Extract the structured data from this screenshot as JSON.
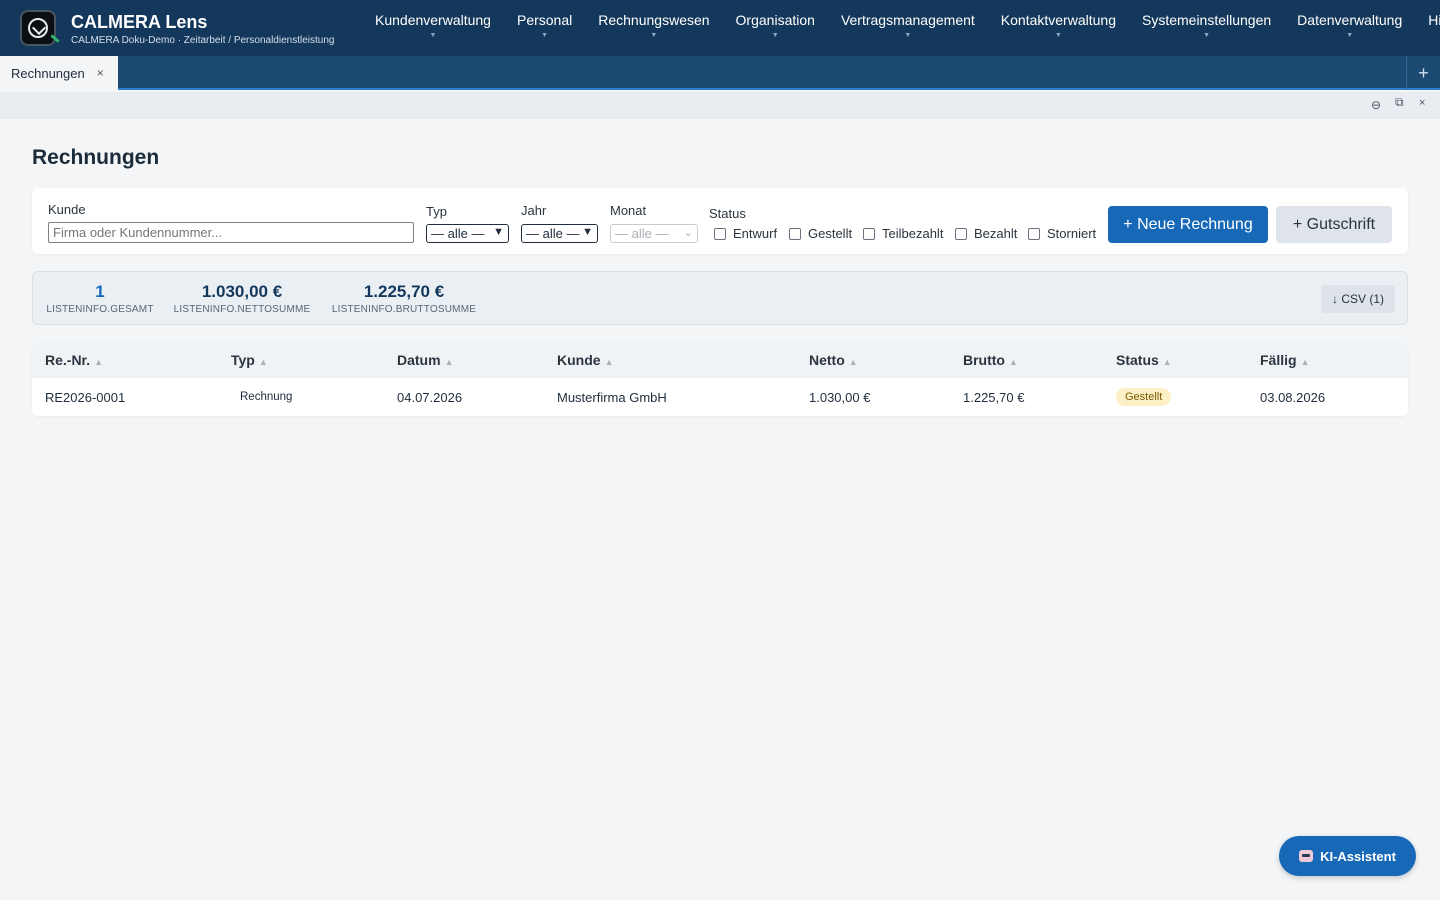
{
  "app": {
    "title": "CALMERA Lens",
    "subtitle": "CALMERA Doku-Demo · Zeitarbeit / Personaldienstleistung"
  },
  "nav": {
    "items": [
      {
        "label": "Kundenverwaltung"
      },
      {
        "label": "Personal"
      },
      {
        "label": "Rechnungswesen"
      },
      {
        "label": "Organisation"
      },
      {
        "label": "Vertragsmanagement"
      },
      {
        "label": "Kontaktverwaltung"
      },
      {
        "label": "Systemeinstellungen"
      },
      {
        "label": "Datenverwaltung"
      },
      {
        "label": "Hilfebe"
      }
    ],
    "caret": "▼"
  },
  "tabs": {
    "active": {
      "label": "Rechnungen",
      "close": "×"
    },
    "add": "+"
  },
  "window": {
    "minimize": "⊖",
    "restore": "⧉",
    "close": "×"
  },
  "page": {
    "title": "Rechnungen"
  },
  "filters": {
    "kunde_label": "Kunde",
    "kunde_placeholder": "Firma oder Kundennummer...",
    "typ_label": "Typ",
    "typ_value": "— alle —",
    "jahr_label": "Jahr",
    "jahr_value": "— alle —",
    "monat_label": "Monat",
    "monat_value": "— alle —",
    "status_label": "Status",
    "status_options": [
      {
        "label": "Entwurf"
      },
      {
        "label": "Gestellt"
      },
      {
        "label": "Teilbezahlt"
      },
      {
        "label": "Bezahlt"
      },
      {
        "label": "Storniert"
      }
    ],
    "new_invoice": "+ Neue Rechnung",
    "credit_note": "+ Gutschrift"
  },
  "summary": {
    "gesamt_value": "1",
    "gesamt_label": "LISTENINFO.GESAMT",
    "netto_value": "1.030,00 €",
    "netto_label": "LISTENINFO.NETTOSUMME",
    "brutto_value": "1.225,70 €",
    "brutto_label": "LISTENINFO.BRUTTOSUMME",
    "csv": "↓ CSV (1)"
  },
  "table": {
    "sort_glyph": "▲",
    "columns": [
      "Re.-Nr.",
      "Typ",
      "Datum",
      "Kunde",
      "Netto",
      "Brutto",
      "Status",
      "Fällig"
    ],
    "rows": [
      {
        "nr": "RE2026-0001",
        "typ": "Rechnung",
        "datum": "04.07.2026",
        "kunde": "Musterfirma GmbH",
        "netto": "1.030,00 €",
        "brutto": "1.225,70 €",
        "status": "Gestellt",
        "faellig": "03.08.2026"
      }
    ]
  },
  "assistant": {
    "label": "KI-Assistent"
  },
  "colors": {
    "topbar": "#14385b",
    "accent": "#1769b8",
    "status_gestellt_bg": "#fdefc6"
  }
}
